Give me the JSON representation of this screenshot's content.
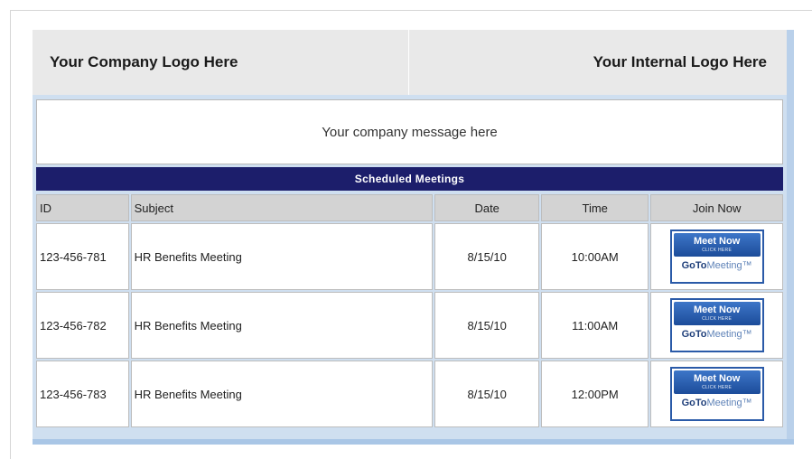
{
  "header": {
    "left_logo": "Your Company Logo Here",
    "right_logo": "Your Internal Logo Here"
  },
  "message": "Your company message here",
  "section_title": "Scheduled Meetings",
  "table": {
    "columns": [
      "ID",
      "Subject",
      "Date",
      "Time",
      "Join Now"
    ],
    "rows": [
      {
        "id": "123-456-781",
        "subject": "HR Benefits Meeting",
        "date": "8/15/10",
        "time": "10:00AM"
      },
      {
        "id": "123-456-782",
        "subject": "HR Benefits Meeting",
        "date": "8/15/10",
        "time": "11:00AM"
      },
      {
        "id": "123-456-783",
        "subject": "HR Benefits Meeting",
        "date": "8/15/10",
        "time": "12:00PM"
      }
    ]
  },
  "join_button": {
    "label": "Meet Now",
    "sublabel": "CLICK HERE",
    "brand_bold": "GoTo",
    "brand_rest": "Meeting",
    "brand_mark": "™"
  },
  "colors": {
    "title_bar": "#1c1e6b",
    "panel_accent": "#b9d0ea",
    "button_blue": "#2a5aa8"
  }
}
